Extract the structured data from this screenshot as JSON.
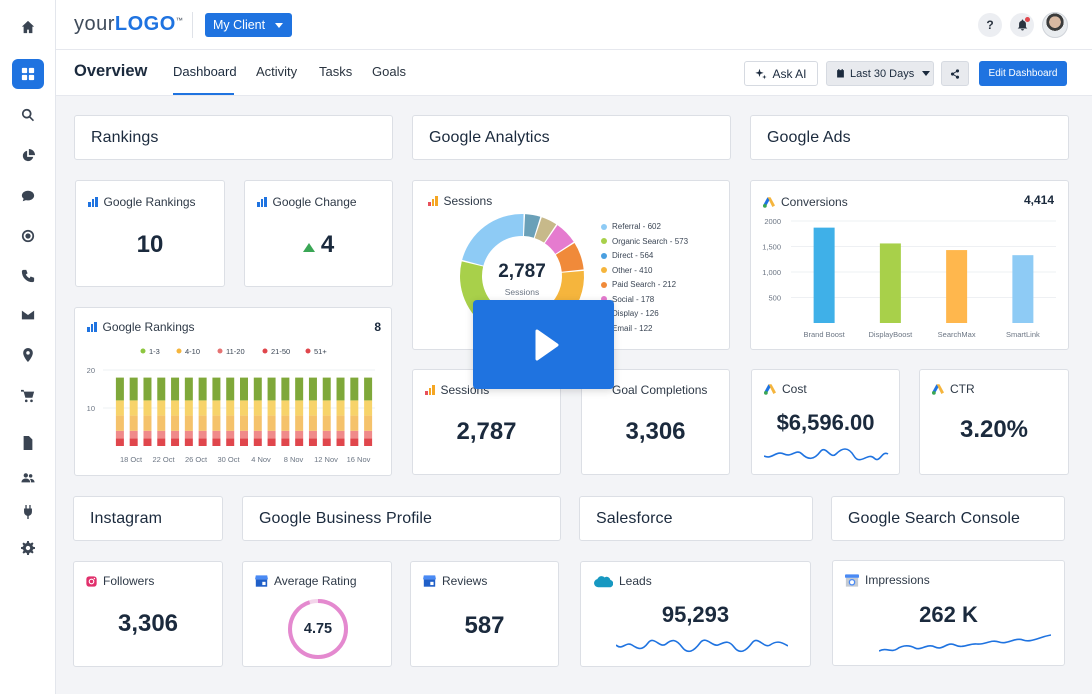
{
  "brand": {
    "logo_plain": "your",
    "logo_bold": "LOGO",
    "logo_tm": "™",
    "accent": "#1f73e0"
  },
  "topbar": {
    "client": "My Client",
    "help": "?",
    "notifications_icon": "bell-icon"
  },
  "sidebar": {
    "icons": [
      "home-icon",
      "dashboard-icon",
      "search-icon",
      "pie-chart-icon",
      "chat-icon",
      "target-icon",
      "phone-icon",
      "mail-icon",
      "location-icon",
      "cart-icon",
      "document-icon",
      "users-icon",
      "plug-icon",
      "gear-icon"
    ]
  },
  "subnav": {
    "title": "Overview",
    "tabs": [
      "Dashboard",
      "Activity",
      "Tasks",
      "Goals"
    ],
    "ask_ai": "Ask AI",
    "date_range": "Last 30 Days",
    "edit": "Edit Dashboard"
  },
  "sections": {
    "rankings": "Rankings",
    "analytics": "Google Analytics",
    "ads": "Google Ads",
    "instagram": "Instagram",
    "gbp": "Google Business Profile",
    "salesforce": "Salesforce",
    "gsc": "Google Search Console"
  },
  "widgets": {
    "google_rankings": {
      "label": "Google Rankings",
      "value": "10"
    },
    "google_change": {
      "label": "Google Change",
      "value": "4"
    },
    "sessions_chart": {
      "label": "Sessions",
      "center_value": "2,787",
      "center_label": "Sessions"
    },
    "conversions": {
      "label": "Conversions",
      "value": "4,414"
    },
    "rankings_chart": {
      "label": "Google Rankings",
      "value": "8"
    },
    "sessions": {
      "label": "Sessions",
      "value": "2,787"
    },
    "goal_completions": {
      "label": "Goal Completions",
      "value": "3,306"
    },
    "cost": {
      "label": "Cost",
      "value": "$6,596.00"
    },
    "ctr": {
      "label": "CTR",
      "value": "3.20%"
    },
    "followers": {
      "label": "Followers",
      "value": "3,306"
    },
    "avg_rating": {
      "label": "Average Rating",
      "value": "4.75",
      "rating": 4.75,
      "max": 5
    },
    "reviews": {
      "label": "Reviews",
      "value": "587"
    },
    "leads": {
      "label": "Leads",
      "value": "95,293"
    },
    "impressions": {
      "label": "Impressions",
      "value": "262 K"
    }
  },
  "chart_data": [
    {
      "type": "pie",
      "title": "Sessions",
      "categories": [
        "Referral",
        "Organic Search",
        "Direct",
        "Other",
        "Paid Search",
        "Social",
        "Display",
        "Email"
      ],
      "values": [
        602,
        573,
        564,
        410,
        212,
        178,
        126,
        122
      ],
      "legend": [
        "Referral - 602",
        "Organic Search - 573",
        "Direct - 564",
        "Other - 410",
        "Paid Search - 212",
        "Social - 178",
        "Display - 126",
        "Email - 122"
      ],
      "colors": [
        "#8ecbf5",
        "#a8d04a",
        "#4a9fe0",
        "#f5b53d",
        "#f08a3a",
        "#e57bcf",
        "#c7b98a",
        "#6aa0b8"
      ]
    },
    {
      "type": "bar",
      "title": "Conversions",
      "categories": [
        "Brand Boost",
        "DisplayBoost",
        "SearchMax",
        "SmartLink"
      ],
      "values": [
        1870,
        1560,
        1430,
        1330
      ],
      "yticks": [
        "2000",
        "1,500",
        "1,000",
        "500"
      ],
      "ylim": [
        0,
        2000
      ],
      "colors": [
        "#3fb0e8",
        "#a8d04a",
        "#ffb74d",
        "#8ecbf5"
      ]
    },
    {
      "type": "bar",
      "title": "Google Rankings",
      "stacked": true,
      "legend": [
        "1-3",
        "4-10",
        "11-20",
        "21-50",
        "51+"
      ],
      "legend_colors": [
        "#8dc63f",
        "#f5b53d",
        "#e57373",
        "#e0464c",
        "#e0464c"
      ],
      "xticks": [
        "18 Oct",
        "22 Oct",
        "26 Oct",
        "30 Oct",
        "4 Nov",
        "8 Nov",
        "12 Nov",
        "16 Nov"
      ],
      "yticks": [
        "20",
        "10"
      ],
      "ylim": [
        0,
        20
      ],
      "bar_count": 19,
      "series": [
        {
          "name": "51+",
          "values": [
            2,
            2,
            2,
            2,
            2,
            2,
            2,
            2,
            2,
            2,
            2,
            2,
            2,
            2,
            2,
            2,
            2,
            2,
            2
          ]
        },
        {
          "name": "21-50",
          "values": [
            2,
            2,
            2,
            2,
            2,
            2,
            2,
            2,
            2,
            2,
            2,
            2,
            2,
            2,
            2,
            2,
            2,
            2,
            2
          ]
        },
        {
          "name": "11-20",
          "values": [
            4,
            4,
            4,
            4,
            4,
            4,
            4,
            4,
            4,
            4,
            4,
            4,
            4,
            4,
            4,
            4,
            4,
            4,
            4
          ]
        },
        {
          "name": "4-10",
          "values": [
            4,
            4,
            4,
            4,
            4,
            4,
            4,
            4,
            4,
            4,
            4,
            4,
            4,
            4,
            4,
            4,
            4,
            4,
            4
          ]
        },
        {
          "name": "1-3",
          "values": [
            6,
            6,
            6,
            6,
            6,
            6,
            6,
            6,
            6,
            6,
            6,
            6,
            6,
            6,
            6,
            6,
            6,
            6,
            6
          ]
        }
      ]
    }
  ]
}
